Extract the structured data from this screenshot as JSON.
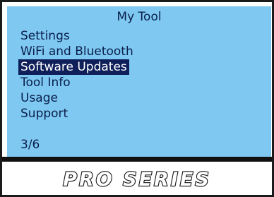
{
  "screen": {
    "title": "My Tool",
    "menu": [
      {
        "label": "Settings",
        "selected": false
      },
      {
        "label": "WiFi and Bluetooth",
        "selected": false
      },
      {
        "label": "Software Updates",
        "selected": true
      },
      {
        "label": "Tool Info",
        "selected": false
      },
      {
        "label": "Usage",
        "selected": false
      },
      {
        "label": "Support",
        "selected": false
      }
    ],
    "page_indicator": "3/6"
  },
  "brand": {
    "logo_text": "PRO SERIES"
  },
  "colors": {
    "screen_background": "#7ec8f2",
    "text": "#0a1f4a",
    "selection_background": "#0f1f5a",
    "selection_text": "#ffffff",
    "frame": "#111111"
  }
}
